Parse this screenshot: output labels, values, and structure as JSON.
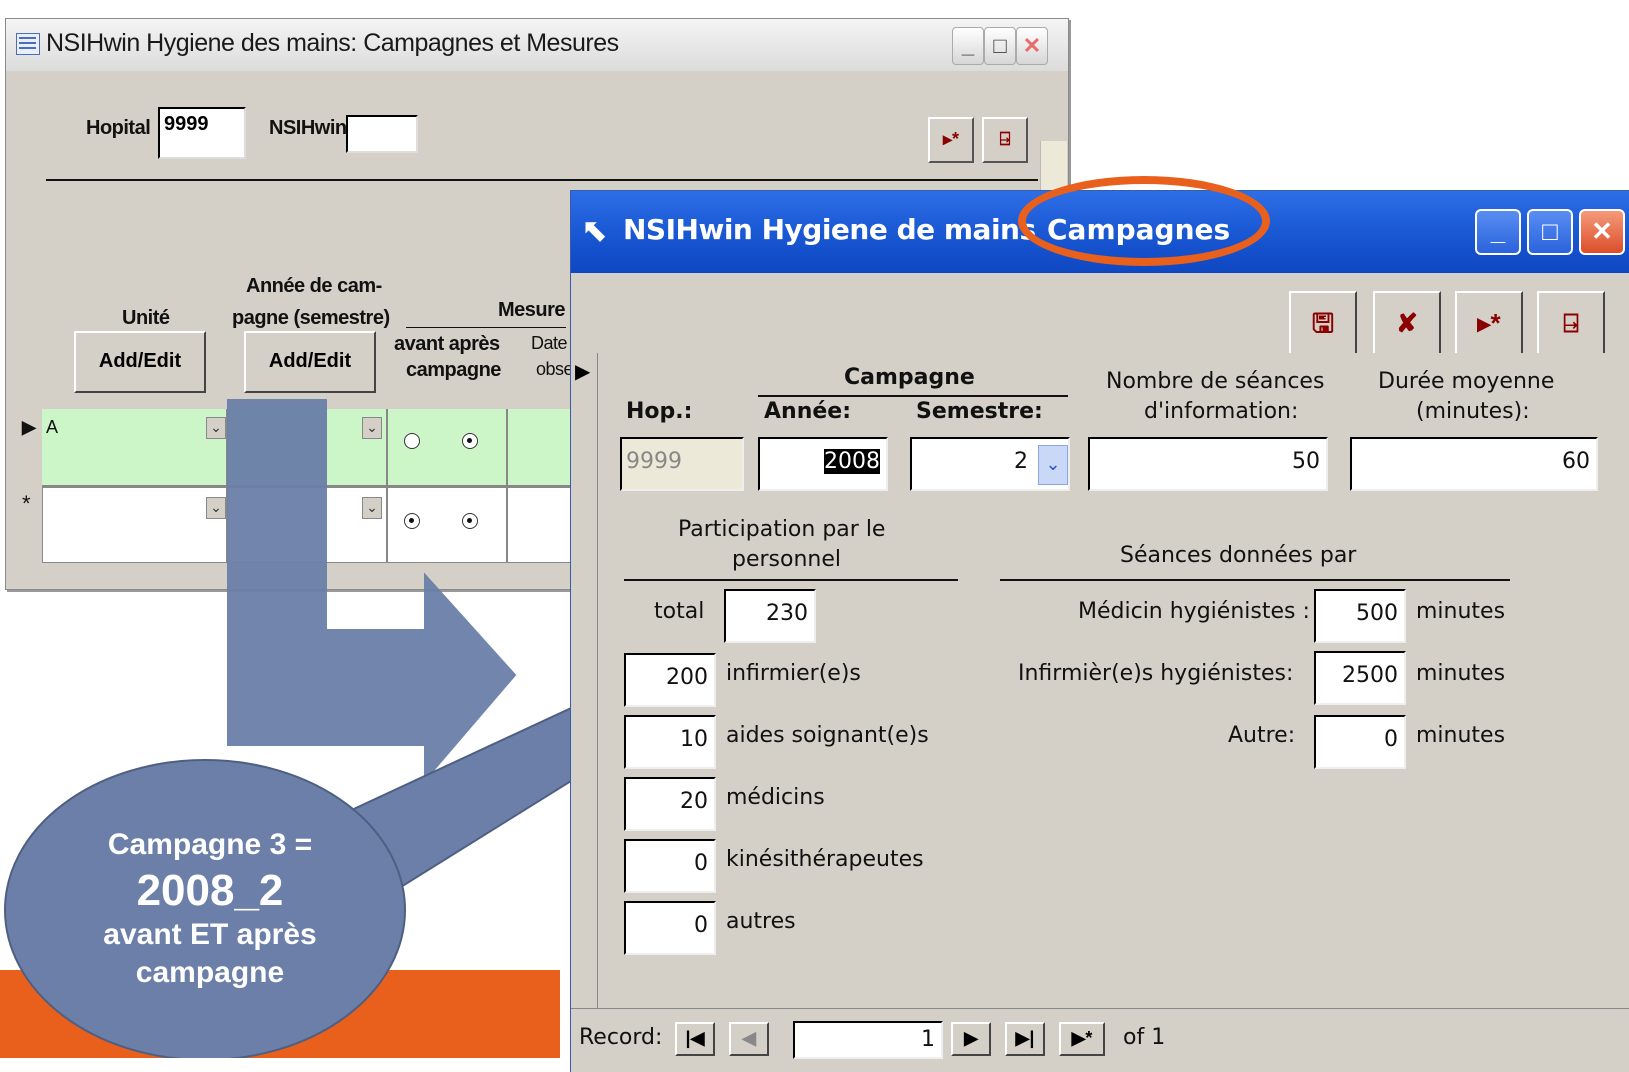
{
  "colors": {
    "accent_orange": "#e8601c",
    "arrow_blue": "#6b7fa8",
    "xp_title_blue": "#1a58d4",
    "row_green": "#ccf5c8"
  },
  "back_window": {
    "title": "NSIHwin Hygiene des mains: Campagnes et Mesures",
    "hopital_label": "Hopital",
    "hopital_value": "9999",
    "nsihwin_label": "NSIHwin",
    "nsihwin_value": "",
    "col_unite": "Unité",
    "col_annee_line1": "Année de cam-",
    "col_annee_line2": "pagne (semestre)",
    "col_mesure": "Mesure",
    "col_avant_apres": "avant  après",
    "col_campagne": "campagne",
    "col_date": "Date",
    "col_obs": "obse",
    "add_edit_1": "Add/Edit",
    "add_edit_2": "Add/Edit",
    "row1_unite": "A",
    "new_row_marker": "*",
    "icons": [
      "new-record-icon",
      "exit-door-icon",
      "minimize-icon",
      "maximize-icon",
      "close-icon",
      "form-icon"
    ]
  },
  "front_window": {
    "title_part1": "NSIHwin Hygiene de mains",
    "title_part2": "Campagnes",
    "campagne_header": "Campagne",
    "hop_label": "Hop.:",
    "annee_label": "Année:",
    "semestre_label": "Semestre:",
    "seances_info_line1": "Nombre de séances",
    "seances_info_line2": "d'information:",
    "duree_line1": "Durée moyenne",
    "duree_line2": "(minutes):",
    "hop_value": "9999",
    "annee_value": "2008",
    "semestre_value": "2",
    "seances_value": "50",
    "duree_value": "60",
    "participation_line1": "Participation par le",
    "participation_line2": "personnel",
    "seances_donnees_par": "Séances données par",
    "total_label": "total",
    "total_value": "230",
    "infirmiers_value": "200",
    "infirmiers_label": "infirmier(e)s",
    "aides_value": "10",
    "aides_label": "aides soignant(e)s",
    "medicins_value": "20",
    "medicins_label": "médicins",
    "kine_value": "0",
    "kine_label": "kinésithérapeutes",
    "autres_value": "0",
    "autres_label": "autres",
    "medicin_hyg_label": "Médicin hygiénistes :",
    "medicin_hyg_value": "500",
    "infirm_hyg_label": "Infirmièr(e)s hygiénistes:",
    "infirm_hyg_value": "2500",
    "autre_label": "Autre:",
    "autre_value": "0",
    "minutes_1": "minutes",
    "minutes_2": "minutes",
    "minutes_3": "minutes",
    "record_label": "Record:",
    "record_value": "1",
    "record_of": "of  1"
  },
  "callout": {
    "line1": "Campagne 3 =",
    "line2": "2008_2",
    "line3": "avant ET après",
    "line4": "campagne"
  }
}
